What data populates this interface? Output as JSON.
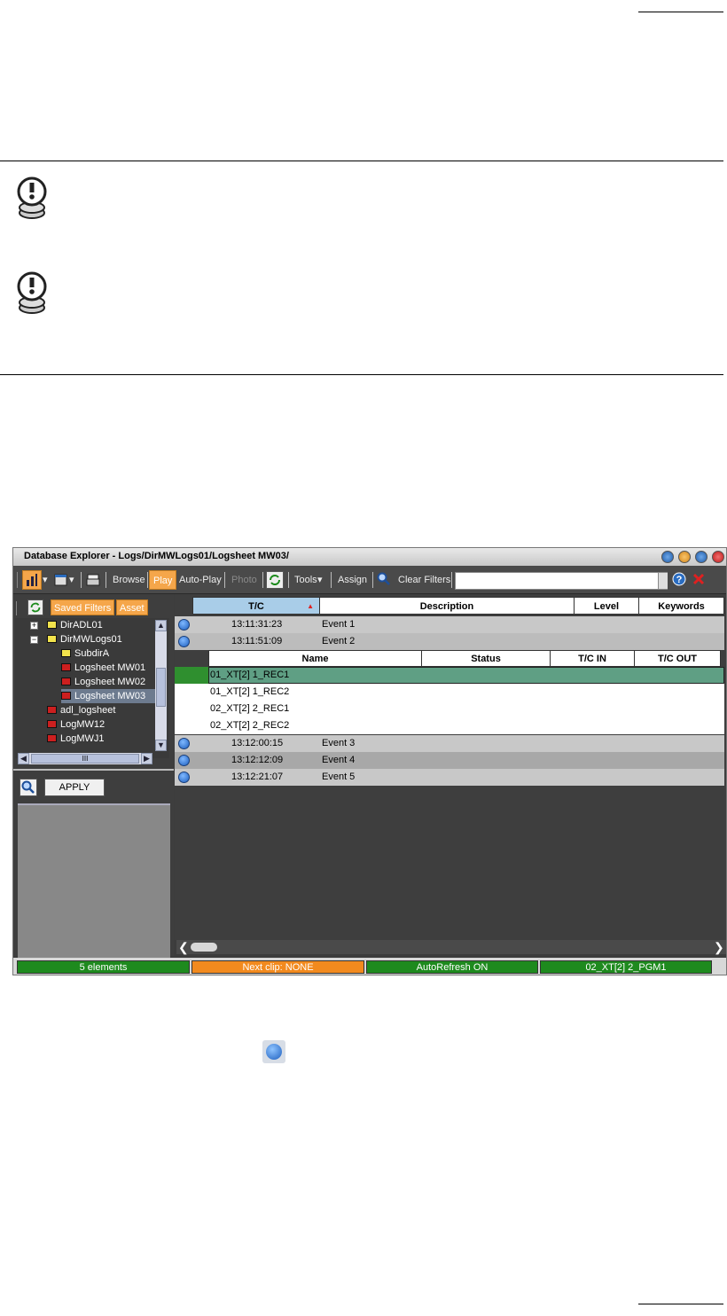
{
  "window": {
    "title": "Database Explorer - Logs/DirMWLogs01/Logsheet MW03/"
  },
  "toolbar": {
    "browse": "Browse",
    "play": "Play",
    "auto_play": "Auto-Play",
    "photo": "Photo",
    "tools": "Tools",
    "assign": "Assign",
    "clear_filters": "Clear Filters",
    "search_value": "",
    "accent_color": "#f5a64a"
  },
  "left_panel": {
    "tabs": [
      "Saved Filters",
      "Asset"
    ],
    "tree": [
      {
        "label": "DirADL01",
        "type": "folder"
      },
      {
        "label": "DirMWLogs01",
        "type": "folder-open"
      },
      {
        "label": "SubdirA",
        "type": "folder"
      },
      {
        "label": "Logsheet MW01",
        "type": "logsheet"
      },
      {
        "label": "Logsheet MW02",
        "type": "logsheet"
      },
      {
        "label": "Logsheet MW03",
        "type": "logsheet",
        "selected": true
      },
      {
        "label": "adl_logsheet",
        "type": "logsheet"
      },
      {
        "label": "LogMW12",
        "type": "logsheet"
      },
      {
        "label": "LogMWJ1",
        "type": "logsheet"
      }
    ],
    "apply_label": "APPLY",
    "hscroll_grip": "III"
  },
  "grid": {
    "columns": [
      "T/C",
      "Description",
      "Level",
      "Keywords"
    ],
    "events": [
      {
        "tc": "13:11:31:23",
        "description": "Event 1"
      },
      {
        "tc": "13:11:51:09",
        "description": "Event 2"
      },
      {
        "tc": "13:12:00:15",
        "description": "Event 3"
      },
      {
        "tc": "13:12:12:09",
        "description": "Event 4"
      },
      {
        "tc": "13:12:21:07",
        "description": "Event 5"
      }
    ],
    "sub_columns": [
      "Name",
      "Status",
      "T/C IN",
      "T/C OUT"
    ],
    "clips": [
      "01_XT[2] 1_REC1",
      "01_XT[2] 1_REC2",
      "02_XT[2] 2_REC1",
      "02_XT[2] 2_REC2"
    ]
  },
  "status_bar": {
    "elements": "5 elements",
    "next_clip": "Next clip: NONE",
    "autorefresh": "AutoRefresh ON",
    "output": "02_XT[2] 2_PGM1",
    "green": "#1e8a1e",
    "orange": "#f28a1e"
  }
}
